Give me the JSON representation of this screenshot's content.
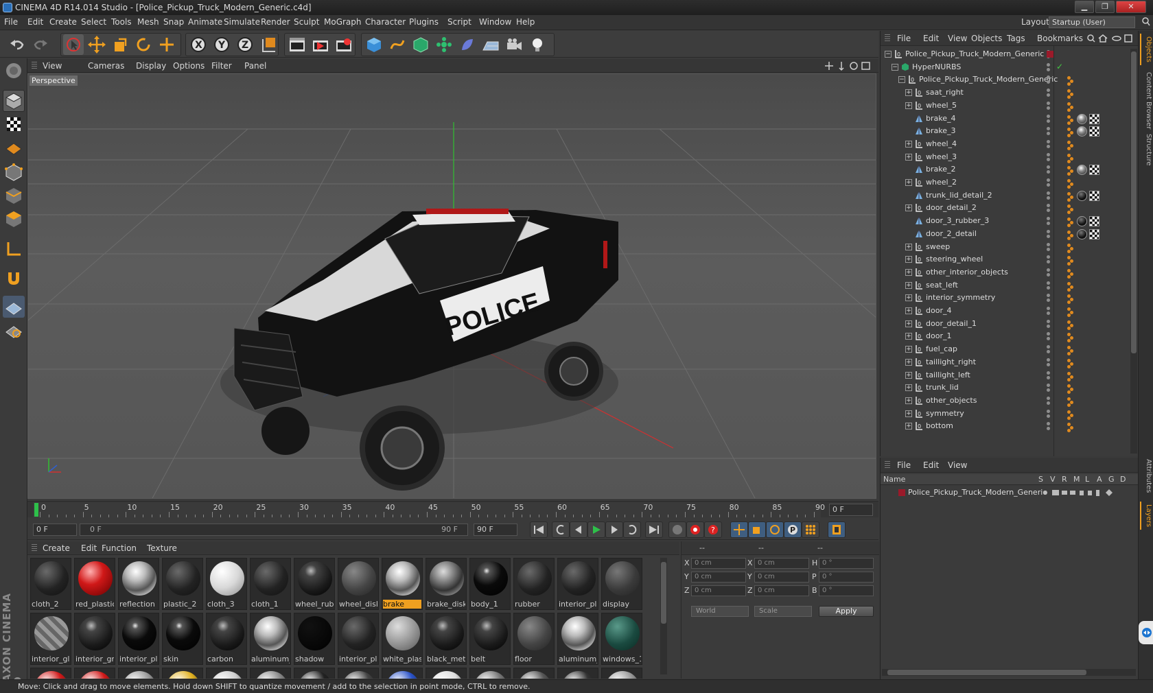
{
  "window": {
    "title": "CINEMA 4D R14.014 Studio - [Police_Pickup_Truck_Modern_Generic.c4d]"
  },
  "menubar": {
    "items": [
      "File",
      "Edit",
      "Create",
      "Select",
      "Tools",
      "Mesh",
      "Snap",
      "Animate",
      "Simulate",
      "Render",
      "Sculpt",
      "MoGraph",
      "Character",
      "Plugins",
      "Script",
      "Window",
      "Help"
    ],
    "layout_label": "Layout:",
    "layout_value": "Startup (User)"
  },
  "viewport": {
    "menu": [
      "View",
      "Cameras",
      "Display",
      "Options",
      "Filter",
      "Panel"
    ],
    "label": "Perspective"
  },
  "timeline": {
    "ticks": [
      "0",
      "5",
      "10",
      "15",
      "20",
      "25",
      "30",
      "35",
      "40",
      "45",
      "50",
      "55",
      "60",
      "65",
      "70",
      "75",
      "80",
      "85",
      "90"
    ],
    "current_frame": "0 F"
  },
  "animbar": {
    "start_field": "0 F",
    "range_start": "0 F",
    "range_end": "90 F",
    "end_field": "90 F"
  },
  "materials": {
    "menu": [
      "Create",
      "Edit",
      "Function",
      "Texture"
    ],
    "row1": [
      {
        "name": "cloth_2",
        "style": "dark"
      },
      {
        "name": "red_plastic",
        "style": "red"
      },
      {
        "name": "reflection",
        "style": "chrome"
      },
      {
        "name": "plastic_2",
        "style": "dark"
      },
      {
        "name": "cloth_3",
        "style": "white"
      },
      {
        "name": "cloth_1",
        "style": "dark"
      },
      {
        "name": "wheel_rub",
        "style": "darkglossy"
      },
      {
        "name": "wheel_disk",
        "style": "grey"
      },
      {
        "name": "brake",
        "style": "chrome",
        "selected": true
      },
      {
        "name": "brake_disk",
        "style": "chromedark"
      },
      {
        "name": "body_1",
        "style": "blackglossy"
      },
      {
        "name": "rubber",
        "style": "dark"
      },
      {
        "name": "interior_pla",
        "style": "dark"
      },
      {
        "name": "display",
        "style": "display"
      }
    ],
    "row2": [
      {
        "name": "interior_gla",
        "style": "glass"
      },
      {
        "name": "interior_gri",
        "style": "darkglossy"
      },
      {
        "name": "interior_pla",
        "style": "blackglossy"
      },
      {
        "name": "skin",
        "style": "blackglossy"
      },
      {
        "name": "carbon",
        "style": "darkglossy"
      },
      {
        "name": "aluminum_",
        "style": "chrome"
      },
      {
        "name": "shadow",
        "style": "black"
      },
      {
        "name": "interior_pla",
        "style": "dark"
      },
      {
        "name": "white_plas",
        "style": "lightgrey"
      },
      {
        "name": "black_meta",
        "style": "darkglossy"
      },
      {
        "name": "belt",
        "style": "darkglossy"
      },
      {
        "name": "floor",
        "style": "grey"
      },
      {
        "name": "aluminum_",
        "style": "chrome"
      },
      {
        "name": "windows_1",
        "style": "green"
      }
    ]
  },
  "coords": {
    "headers": [
      "--",
      "--",
      "--"
    ],
    "rows": [
      {
        "a": "X",
        "av": "0 cm",
        "b": "X",
        "bv": "0 cm",
        "c": "H",
        "cv": "0 °"
      },
      {
        "a": "Y",
        "av": "0 cm",
        "b": "Y",
        "bv": "0 cm",
        "c": "P",
        "cv": "0 °"
      },
      {
        "a": "Z",
        "av": "0 cm",
        "b": "Z",
        "bv": "0 cm",
        "c": "B",
        "cv": "0 °"
      }
    ],
    "world": "World",
    "scale": "Scale",
    "apply": "Apply"
  },
  "objects": {
    "menu": [
      "File",
      "Edit",
      "View",
      "Objects",
      "Tags",
      "Bookmarks"
    ],
    "rows": [
      {
        "name": "Police_Pickup_Truck_Modern_Generic",
        "level": 0,
        "type": "null",
        "tags": "red"
      },
      {
        "name": "HyperNURBS",
        "level": 1,
        "type": "nurbs",
        "tags": "check"
      },
      {
        "name": "Police_Pickup_Truck_Modern_Generic",
        "level": 2,
        "type": "null",
        "tags": "dot"
      },
      {
        "name": "saat_right",
        "level": 3,
        "type": "null",
        "tags": "dot"
      },
      {
        "name": "wheel_5",
        "level": 3,
        "type": "null",
        "tags": "dot"
      },
      {
        "name": "brake_4",
        "level": 3,
        "type": "poly",
        "tags": "full"
      },
      {
        "name": "brake_3",
        "level": 3,
        "type": "poly",
        "tags": "full"
      },
      {
        "name": "wheel_4",
        "level": 3,
        "type": "null",
        "tags": "dot"
      },
      {
        "name": "wheel_3",
        "level": 3,
        "type": "null",
        "tags": "dot"
      },
      {
        "name": "brake_2",
        "level": 3,
        "type": "poly",
        "tags": "full"
      },
      {
        "name": "wheel_2",
        "level": 3,
        "type": "null",
        "tags": "dot"
      },
      {
        "name": "trunk_lid_detail_2",
        "level": 3,
        "type": "poly",
        "tags": "fulldark"
      },
      {
        "name": "door_detail_2",
        "level": 3,
        "type": "null",
        "tags": "dot"
      },
      {
        "name": "door_3_rubber_3",
        "level": 3,
        "type": "poly",
        "tags": "fulldark"
      },
      {
        "name": "door_2_detail",
        "level": 3,
        "type": "poly",
        "tags": "fulldark"
      },
      {
        "name": "sweep",
        "level": 3,
        "type": "null",
        "tags": "dot"
      },
      {
        "name": "steering_wheel",
        "level": 3,
        "type": "null",
        "tags": "dot"
      },
      {
        "name": "other_interior_objects",
        "level": 3,
        "type": "null",
        "tags": "dot"
      },
      {
        "name": "seat_left",
        "level": 3,
        "type": "null",
        "tags": "dot"
      },
      {
        "name": "interior_symmetry",
        "level": 3,
        "type": "null",
        "tags": "dot"
      },
      {
        "name": "door_4",
        "level": 3,
        "type": "null",
        "tags": "dot"
      },
      {
        "name": "door_detail_1",
        "level": 3,
        "type": "null",
        "tags": "dot"
      },
      {
        "name": "door_1",
        "level": 3,
        "type": "null",
        "tags": "dot"
      },
      {
        "name": "fuel_cap",
        "level": 3,
        "type": "null",
        "tags": "dot"
      },
      {
        "name": "taillight_right",
        "level": 3,
        "type": "null",
        "tags": "dot"
      },
      {
        "name": "taillight_left",
        "level": 3,
        "type": "null",
        "tags": "dot"
      },
      {
        "name": "trunk_lid",
        "level": 3,
        "type": "null",
        "tags": "dot"
      },
      {
        "name": "other_objects",
        "level": 3,
        "type": "null",
        "tags": "dot"
      },
      {
        "name": "symmetry",
        "level": 3,
        "type": "null",
        "tags": "dot"
      },
      {
        "name": "bottom",
        "level": 3,
        "type": "null",
        "tags": "dot"
      }
    ]
  },
  "attributes": {
    "menu": [
      "File",
      "Edit",
      "View"
    ],
    "col_name": "Name",
    "cols": [
      "S",
      "V",
      "R",
      "M",
      "L",
      "A",
      "G",
      "D"
    ],
    "row_name": "Police_Pickup_Truck_Modern_Generic"
  },
  "right_tabs": [
    "Objects",
    "Content Browser",
    "Structure",
    "Attributes",
    "Layers"
  ],
  "brand": "MAXON CINEMA 4D",
  "statusbar": "Move: Click and drag to move elements. Hold down SHIFT to quantize movement / add to the selection in point mode, CTRL to remove.",
  "colors": {
    "accent": "#f0a020",
    "axis_x": "#d03030",
    "axis_y": "#30c030",
    "axis_z": "#3060d0"
  }
}
